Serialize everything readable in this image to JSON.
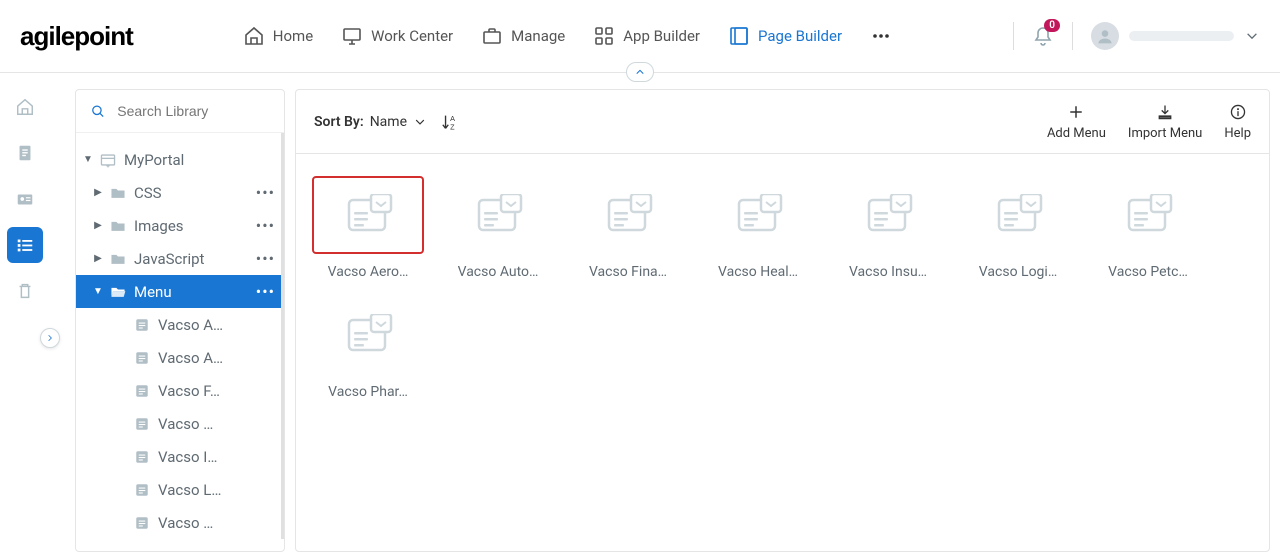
{
  "brand": "agilepoint",
  "nav": {
    "items": [
      {
        "label": "Home",
        "icon": "home-icon",
        "active": false
      },
      {
        "label": "Work Center",
        "icon": "monitor-icon",
        "active": false
      },
      {
        "label": "Manage",
        "icon": "briefcase-icon",
        "active": false
      },
      {
        "label": "App Builder",
        "icon": "apps-icon",
        "active": false
      },
      {
        "label": "Page Builder",
        "icon": "layout-icon",
        "active": true
      }
    ],
    "notification_count": "0"
  },
  "rail": {
    "items": [
      {
        "icon": "home-outline-icon",
        "active": false
      },
      {
        "icon": "document-icon",
        "active": false
      },
      {
        "icon": "id-card-icon",
        "active": false
      },
      {
        "icon": "list-icon",
        "active": true
      },
      {
        "icon": "trash-icon",
        "active": false
      }
    ]
  },
  "sidebar": {
    "search_placeholder": "Search Library",
    "tree": [
      {
        "level": 0,
        "caret": "down",
        "icon": "portal-icon",
        "label": "MyPortal",
        "menu": false
      },
      {
        "level": 1,
        "caret": "right",
        "icon": "folder-icon",
        "label": "CSS",
        "menu": true
      },
      {
        "level": 1,
        "caret": "right",
        "icon": "folder-icon",
        "label": "Images",
        "menu": true
      },
      {
        "level": 1,
        "caret": "right",
        "icon": "folder-icon",
        "label": "JavaScript",
        "menu": true
      },
      {
        "level": 1,
        "caret": "down",
        "icon": "folder-open-icon",
        "label": "Menu",
        "menu": true,
        "selected": true
      },
      {
        "level": 2,
        "icon": "menu-file-icon",
        "label": "Vacso A…"
      },
      {
        "level": 2,
        "icon": "menu-file-icon",
        "label": "Vacso A…"
      },
      {
        "level": 2,
        "icon": "menu-file-icon",
        "label": "Vacso F…"
      },
      {
        "level": 2,
        "icon": "menu-file-icon",
        "label": "Vacso …"
      },
      {
        "level": 2,
        "icon": "menu-file-icon",
        "label": "Vacso I…"
      },
      {
        "level": 2,
        "icon": "menu-file-icon",
        "label": "Vacso L…"
      },
      {
        "level": 2,
        "icon": "menu-file-icon",
        "label": "Vacso …"
      }
    ]
  },
  "toolbar": {
    "sort_by_label": "Sort By:",
    "sort_field": "Name",
    "actions": [
      {
        "label": "Add Menu",
        "icon": "plus-icon"
      },
      {
        "label": "Import Menu",
        "icon": "download-icon"
      },
      {
        "label": "Help",
        "icon": "info-icon"
      }
    ]
  },
  "cards": [
    {
      "label": "Vacso Aero…",
      "selected": true
    },
    {
      "label": "Vacso Auto…",
      "selected": false
    },
    {
      "label": "Vacso Fina…",
      "selected": false
    },
    {
      "label": "Vacso Heal…",
      "selected": false
    },
    {
      "label": "Vacso Insu…",
      "selected": false
    },
    {
      "label": "Vacso Logi…",
      "selected": false
    },
    {
      "label": "Vacso Petc…",
      "selected": false
    },
    {
      "label": "Vacso Phar…",
      "selected": false
    }
  ]
}
